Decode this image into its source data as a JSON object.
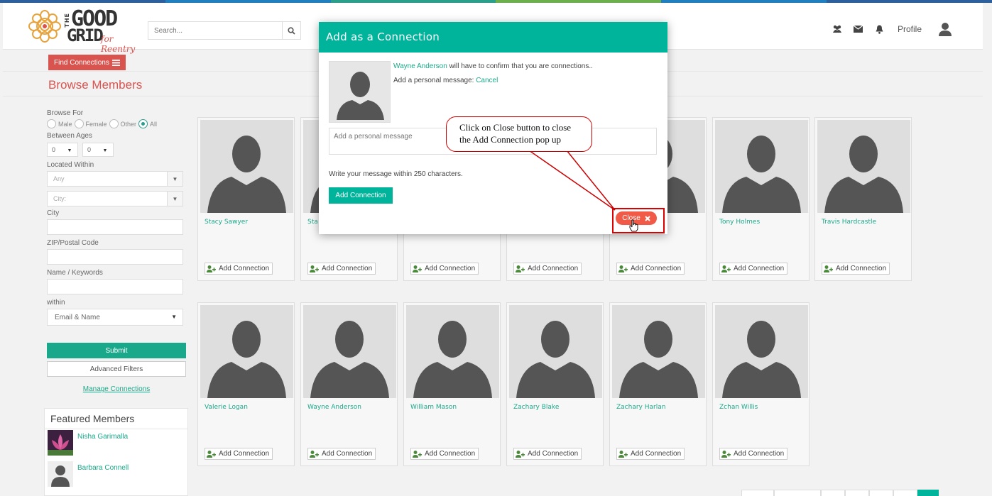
{
  "colors": {
    "teal": "#00b49c",
    "red": "#d9534f",
    "close": "#f05a47",
    "stripe": [
      "#2b5f9e",
      "#1f7fbf",
      "#2aa08a",
      "#6bb04a",
      "#1f7fbf",
      "#2b5f9e"
    ]
  },
  "header": {
    "logo": {
      "the": "THE",
      "good": "GOOD",
      "grid": "GRID",
      "tagline": "for Reentry"
    },
    "search_placeholder": "Search...",
    "search_icon": "search-icon",
    "icons": [
      "users-icon",
      "envelope-icon",
      "bell-icon"
    ],
    "profile_label": "Profile"
  },
  "toolbar": {
    "find_connections": "Find Connections"
  },
  "page_title": "Browse Members",
  "filters": {
    "browse_for_label": "Browse For",
    "gender_options": [
      {
        "label": "Male",
        "selected": false
      },
      {
        "label": "Female",
        "selected": false
      },
      {
        "label": "Other",
        "selected": false
      },
      {
        "label": "All",
        "selected": true
      }
    ],
    "between_ages_label": "Between Ages",
    "age_from": "0",
    "age_to": "0",
    "located_within_label": "Located Within",
    "located_within_value": "Any",
    "city_select_placeholder": "City:",
    "city_label": "City",
    "zip_label": "ZIP/Postal Code",
    "name_keywords_label": "Name / Keywords",
    "within_label": "within",
    "within_value": "Email & Name",
    "submit_label": "Submit",
    "advanced_label": "Advanced Filters",
    "manage_label": "Manage Connections"
  },
  "featured": {
    "title": "Featured Members",
    "members": [
      {
        "name": "Nisha Garimalla"
      },
      {
        "name": "Barbara Connell"
      }
    ]
  },
  "members": [
    {
      "name": "Stacy Sawyer",
      "action": "Add Connection"
    },
    {
      "name": "Sta",
      "action": "Add Connection"
    },
    {
      "name": "",
      "action": "Add Connection"
    },
    {
      "name": "",
      "action": "Add Connection"
    },
    {
      "name": "",
      "action": "Add Connection"
    },
    {
      "name": "Tony Holmes",
      "action": "Add Connection"
    },
    {
      "name": "Travis Hardcastle",
      "action": "Add Connection"
    },
    {
      "name": "Valerie Logan",
      "action": "Add Connection"
    },
    {
      "name": "Wayne Anderson",
      "action": "Add Connection"
    },
    {
      "name": "William Mason",
      "action": "Add Connection"
    },
    {
      "name": "Zachary Blake",
      "action": "Add Connection"
    },
    {
      "name": "Zachary Harlan",
      "action": "Add Connection"
    },
    {
      "name": "Zchan Willis",
      "action": "Add Connection"
    }
  ],
  "modal": {
    "title": "Add as a Connection",
    "target_name": "Wayne Anderson",
    "confirm_text": " will have to confirm that you are connections..",
    "add_message_label": "Add a personal message: ",
    "cancel_label": "Cancel",
    "message_placeholder": "Add a personal message",
    "hint": "Write your message within 250 characters.",
    "add_button": "Add Connection",
    "close_button": "Close"
  },
  "annotation": {
    "text": "Click on Close button to close the Add Connection pop up"
  }
}
